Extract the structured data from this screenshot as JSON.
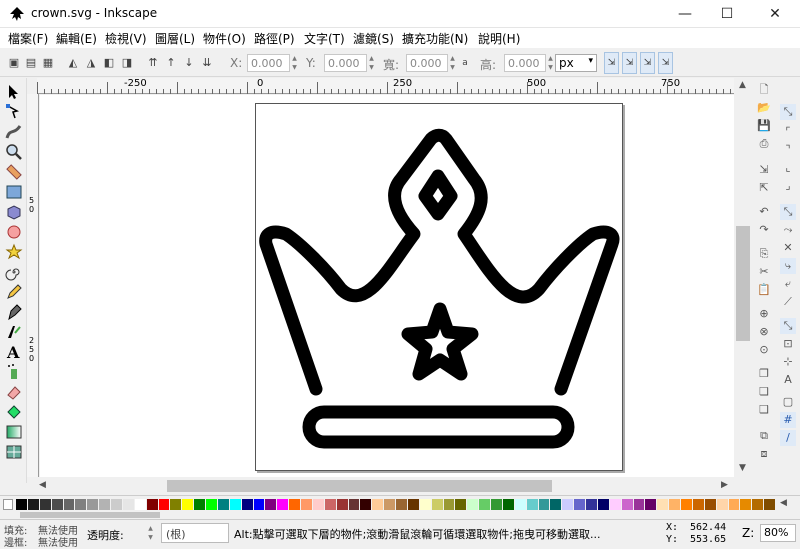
{
  "window": {
    "title": "crown.svg - Inkscape",
    "minimize": "—",
    "maximize": "☐",
    "close": "✕"
  },
  "menu": [
    "檔案(F)",
    "編輯(E)",
    "檢視(V)",
    "圖層(L)",
    "物件(O)",
    "路徑(P)",
    "文字(T)",
    "濾鏡(S)",
    "擴充功能(N)",
    "說明(H)"
  ],
  "toolbar": {
    "x_label": "X:",
    "x_value": "0.000",
    "y_label": "Y:",
    "y_value": "0.000",
    "w_label": "寬:",
    "w_value": "0.000",
    "h_label": "高:",
    "h_value": "0.000",
    "unit": "px"
  },
  "ruler": {
    "h_ticks": [
      "-250",
      "0",
      "250",
      "500",
      "750"
    ],
    "v_ticks": [
      "0",
      "5",
      "0",
      "2",
      "5",
      "0"
    ]
  },
  "status": {
    "fill_label": "填充:",
    "fill_value": "無法使用",
    "stroke_label": "邊框:",
    "stroke_value": "無法使用",
    "opacity_label": "透明度:",
    "layer": "(根)",
    "message": "Alt:點擊可選取下層的物件;滾動滑鼠滾輪可循環選取物件;拖曳可移動選取...",
    "x_label": "X:",
    "x_value": "562.44",
    "y_label": "Y:",
    "y_value": "553.65",
    "zoom_label": "Z:",
    "zoom_value": "80%"
  },
  "colors": {
    "palette": [
      "#000000",
      "#1a1a1a",
      "#333333",
      "#4d4d4d",
      "#666666",
      "#808080",
      "#999999",
      "#b3b3b3",
      "#cccccc",
      "#e6e6e6",
      "#ffffff",
      "#800000",
      "#ff0000",
      "#808000",
      "#ffff00",
      "#008000",
      "#00ff00",
      "#008080",
      "#00ffff",
      "#000080",
      "#0000ff",
      "#800080",
      "#ff00ff",
      "#ff6600",
      "#ff9966",
      "#ffcccc",
      "#cc6666",
      "#993333",
      "#663333",
      "#330000",
      "#ffcc99",
      "#cc9966",
      "#996633",
      "#663300",
      "#ffffcc",
      "#cccc66",
      "#999933",
      "#666600",
      "#ccffcc",
      "#66cc66",
      "#339933",
      "#006600",
      "#ccffff",
      "#66cccc",
      "#339999",
      "#006666",
      "#ccccff",
      "#6666cc",
      "#333399",
      "#000066",
      "#ffccff",
      "#cc66cc",
      "#993399",
      "#660066",
      "#ffe0b3",
      "#ffb366",
      "#ff8000",
      "#cc6600",
      "#994d00",
      "#ffd5aa",
      "#ffaa55",
      "#e68a00",
      "#b36b00",
      "#804d00"
    ],
    "accent_toggle": "#dfeaf7"
  },
  "icons": {
    "left_tools": [
      "select-tool-icon",
      "node-tool-icon",
      "tweak-tool-icon",
      "zoom-tool-icon",
      "measure-tool-icon",
      "rect-tool-icon",
      "3dbox-tool-icon",
      "ellipse-tool-icon",
      "star-tool-icon",
      "spiral-tool-icon",
      "pencil-tool-icon",
      "pen-tool-icon",
      "calligraphy-tool-icon",
      "text-tool-icon",
      "spray-tool-icon",
      "eraser-tool-icon",
      "bucket-tool-icon",
      "gradient-tool-icon",
      "mesh-tool-icon"
    ]
  }
}
